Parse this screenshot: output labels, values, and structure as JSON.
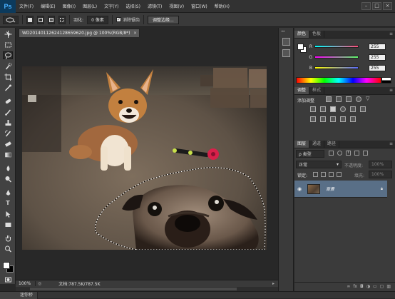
{
  "app": {
    "logo": "Ps"
  },
  "menu": [
    "文件(F)",
    "编辑(E)",
    "图像(I)",
    "图层(L)",
    "文字(Y)",
    "选择(S)",
    "滤镜(T)",
    "视图(V)",
    "窗口(W)",
    "帮助(H)"
  ],
  "window_controls": [
    "–",
    "□",
    "×"
  ],
  "options": {
    "feather_label": "羽化:",
    "feather_value": "0 像素",
    "antialias_label": "消除锯齿",
    "refine_edge": "调整边缘..."
  },
  "document": {
    "tab_title": "WD20140112624128659620.jpg @ 100%(RGB/8*)",
    "close": "×",
    "zoom": "100%",
    "doc_info": "文档:787.5K/787.5K"
  },
  "mini_bridge": {
    "label": "迷你桥"
  },
  "panels": {
    "color_tabs": [
      "颜色",
      "色板"
    ],
    "rgb": [
      {
        "label": "R",
        "value": "255",
        "color": "#ff4f7b"
      },
      {
        "label": "G",
        "value": "255",
        "color": "#5dff6a"
      },
      {
        "label": "B",
        "value": "255",
        "color": "#5a6bff"
      }
    ],
    "adjust_tabs": [
      "调整",
      "样式"
    ],
    "adjust_title": "添加调整",
    "layers_tabs": [
      "图层",
      "通道",
      "路径"
    ],
    "kind": "ρ 类型",
    "blend_mode": "正常",
    "opacity_label": "不透明度:",
    "opacity_value": "100%",
    "lock_label": "锁定:",
    "fill_label": "填充:",
    "fill_value": "100%",
    "layer_name": "背景"
  }
}
